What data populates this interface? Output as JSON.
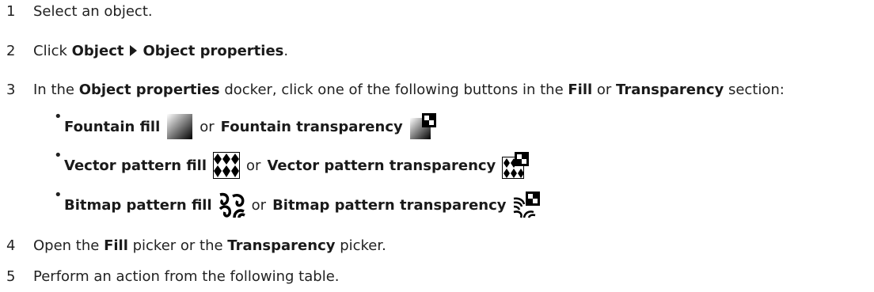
{
  "steps": [
    {
      "num": "1",
      "text": "Select an object."
    },
    {
      "num": "2",
      "pre": "Click ",
      "menu1": "Object",
      "menu2": "Object properties",
      "post": "."
    },
    {
      "num": "3",
      "pre": "In the ",
      "bold1": "Object properties",
      "mid1": " docker, click one of the following buttons in the ",
      "bold2": "Fill",
      "mid2": " or ",
      "bold3": "Transparency",
      "post": " section:"
    },
    {
      "num": "4",
      "pre": "Open the ",
      "bold1": "Fill",
      "mid1": " picker or the ",
      "bold2": "Transparency",
      "post": " picker."
    },
    {
      "num": "5",
      "text": "Perform an action from the following table."
    }
  ],
  "bullets": [
    {
      "fill": "Fountain fill",
      "or": "or",
      "transparency": "Fountain transparency",
      "fill_icon": "fountain-fill-icon",
      "trans_icon": "fountain-transparency-icon"
    },
    {
      "fill": "Vector pattern fill",
      "or": "or",
      "transparency": "Vector pattern transparency",
      "fill_icon": "vector-pattern-fill-icon",
      "trans_icon": "vector-pattern-transparency-icon"
    },
    {
      "fill": "Bitmap pattern fill",
      "or": "or",
      "transparency": "Bitmap pattern transparency",
      "fill_icon": "bitmap-pattern-fill-icon",
      "trans_icon": "bitmap-pattern-transparency-icon"
    }
  ]
}
